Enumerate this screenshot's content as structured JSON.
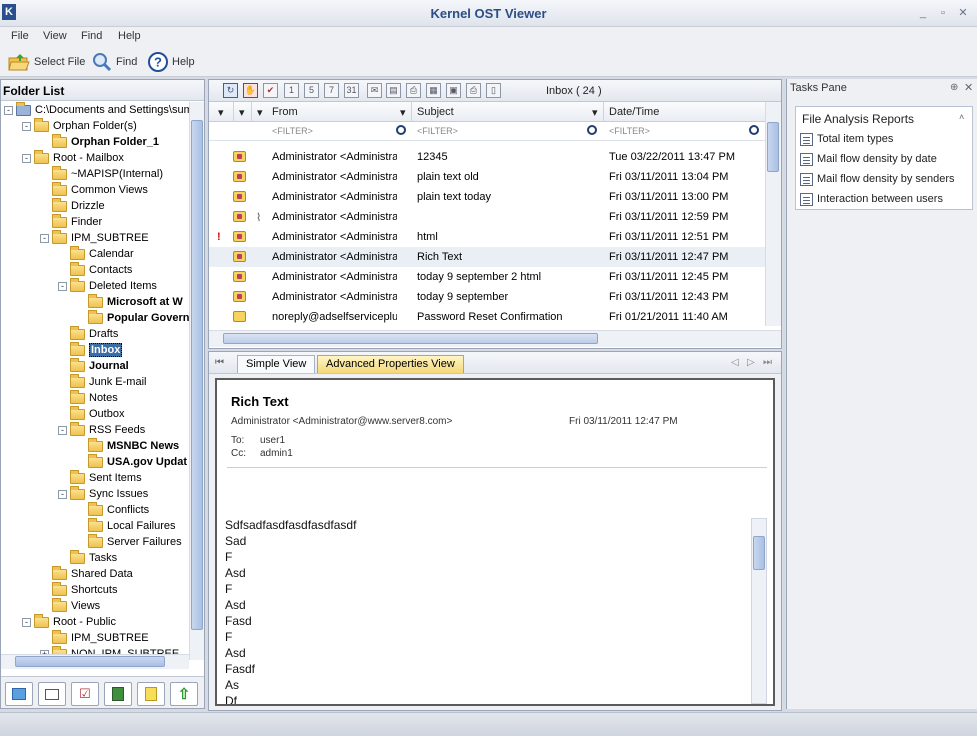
{
  "window": {
    "title": "Kernel OST Viewer",
    "icon_letter": "K"
  },
  "menu": [
    "File",
    "View",
    "Find",
    "Help"
  ],
  "toolbar": {
    "select_file": "Select File",
    "find": "Find",
    "help": "Help"
  },
  "folder_list": {
    "title": "Folder List",
    "items": [
      {
        "label": "C:\\Documents and Settings\\sumar",
        "bold": false
      },
      {
        "label": "Orphan Folder(s)",
        "bold": false
      },
      {
        "label": "Orphan Folder_1",
        "bold": true
      },
      {
        "label": "Root - Mailbox",
        "bold": false
      },
      {
        "label": "~MAPISP(Internal)",
        "bold": false
      },
      {
        "label": "Common Views",
        "bold": false
      },
      {
        "label": "Drizzle",
        "bold": false
      },
      {
        "label": "Finder",
        "bold": false
      },
      {
        "label": "IPM_SUBTREE",
        "bold": false
      },
      {
        "label": "Calendar",
        "bold": false
      },
      {
        "label": "Contacts",
        "bold": false
      },
      {
        "label": "Deleted Items",
        "bold": false
      },
      {
        "label": "Microsoft at W",
        "bold": true
      },
      {
        "label": "Popular Govern",
        "bold": true
      },
      {
        "label": "Drafts",
        "bold": false
      },
      {
        "label": "Inbox",
        "bold": true
      },
      {
        "label": "Journal",
        "bold": true
      },
      {
        "label": "Junk E-mail",
        "bold": false
      },
      {
        "label": "Notes",
        "bold": false
      },
      {
        "label": "Outbox",
        "bold": false
      },
      {
        "label": "RSS Feeds",
        "bold": false
      },
      {
        "label": "MSNBC News",
        "bold": true
      },
      {
        "label": "USA.gov Updat",
        "bold": true
      },
      {
        "label": "Sent Items",
        "bold": false
      },
      {
        "label": "Sync Issues",
        "bold": false
      },
      {
        "label": "Conflicts",
        "bold": false
      },
      {
        "label": "Local Failures",
        "bold": false
      },
      {
        "label": "Server Failures",
        "bold": false
      },
      {
        "label": "Tasks",
        "bold": false
      },
      {
        "label": "Shared Data",
        "bold": false
      },
      {
        "label": "Shortcuts",
        "bold": false
      },
      {
        "label": "Views",
        "bold": false
      },
      {
        "label": "Root - Public",
        "bold": false
      },
      {
        "label": "IPM_SUBTREE",
        "bold": false
      },
      {
        "label": "NON_IPM_SUBTREE",
        "bold": false
      }
    ]
  },
  "message_list": {
    "folder_label": "Inbox ( 24 )",
    "columns": {
      "from": "From",
      "subject": "Subject",
      "date": "Date/Time"
    },
    "filter_placeholder": "<FILTER>",
    "rows": [
      {
        "from": "Administrator <Administrator...",
        "subject": "12345",
        "date": "Tue 03/22/2011 13:47 PM"
      },
      {
        "from": "Administrator <Administrator...",
        "subject": "plain text old",
        "date": "Fri 03/11/2011 13:04 PM"
      },
      {
        "from": "Administrator <Administrator...",
        "subject": "plain text today",
        "date": "Fri 03/11/2011 13:00 PM"
      },
      {
        "from": "Administrator <Administrator...",
        "subject": "",
        "date": "Fri 03/11/2011 12:59 PM"
      },
      {
        "from": "Administrator <Administrator...",
        "subject": "html",
        "date": "Fri 03/11/2011 12:51 PM"
      },
      {
        "from": "Administrator <Administrator...",
        "subject": "Rich Text",
        "date": "Fri 03/11/2011 12:47 PM"
      },
      {
        "from": "Administrator <Administrator...",
        "subject": "today 9 september 2 html",
        "date": "Fri 03/11/2011 12:45 PM"
      },
      {
        "from": "Administrator <Administrator...",
        "subject": "today 9 september",
        "date": "Fri 03/11/2011 12:43 PM"
      },
      {
        "from": "noreply@adselfserviceplus....",
        "subject": "Password Reset Confirmation",
        "date": "Fri 01/21/2011 11:40 AM"
      }
    ]
  },
  "preview": {
    "tabs": {
      "simple": "Simple View",
      "advanced": "Advanced Properties View"
    },
    "subject": "Rich Text",
    "from": "Administrator <Administrator@www.server8.com>",
    "date": "Fri 03/11/2011 12:47 PM",
    "to_label": "To:",
    "to": "user1",
    "cc_label": "Cc:",
    "cc": "admin1",
    "body_lines": [
      "Sdfsadfasdfasdfasdfasdf",
      "Sad",
      "F",
      "Asd",
      "F",
      "Asd",
      "Fasd",
      "F",
      "Asd",
      "Fasdf",
      "As",
      "Df"
    ]
  },
  "tasks_pane": {
    "title": "Tasks Pane",
    "group": "File Analysis Reports",
    "items": [
      "Total item types",
      "Mail flow density by date",
      "Mail flow density by senders",
      "Interaction between users"
    ]
  }
}
